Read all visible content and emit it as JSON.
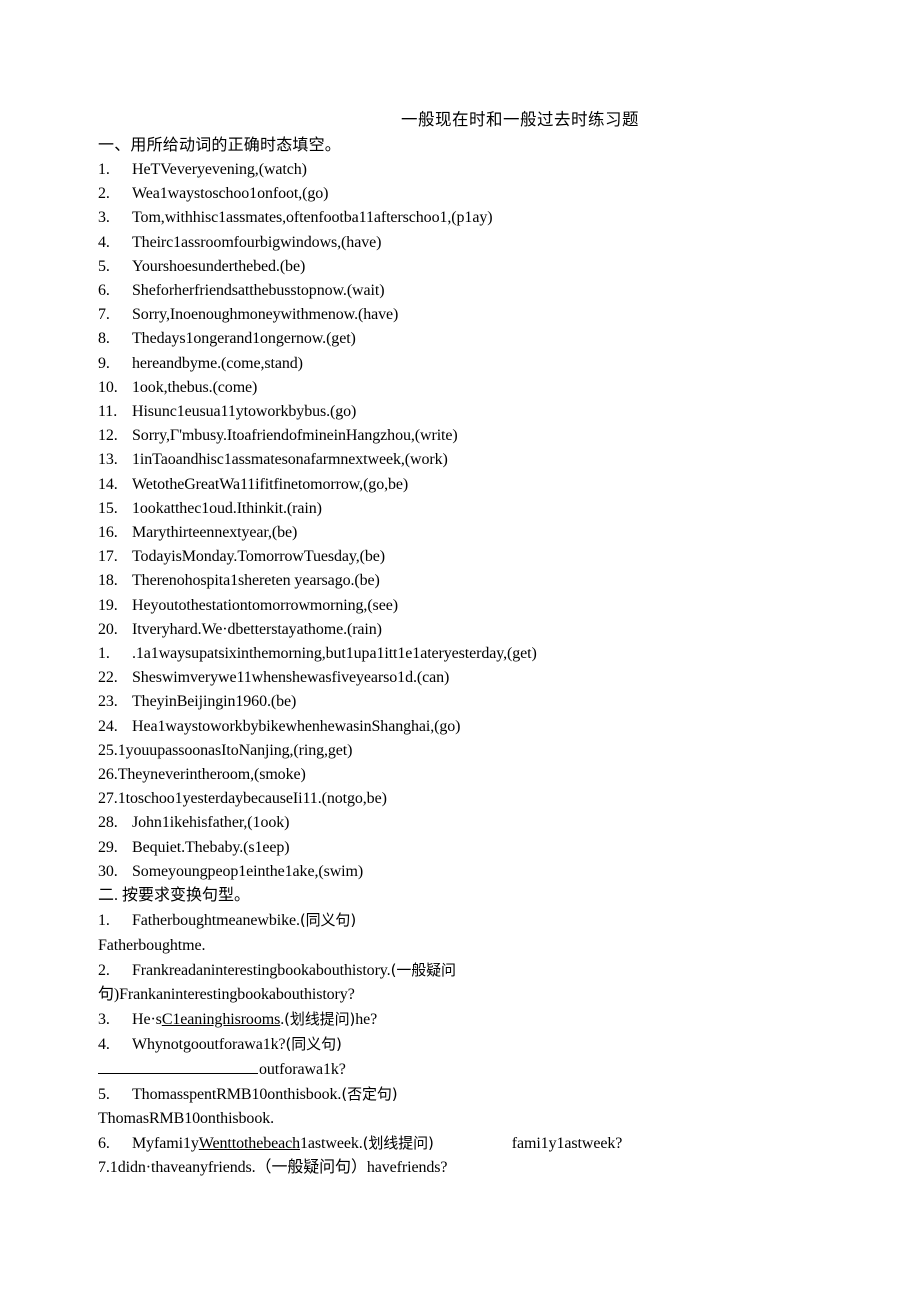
{
  "document": {
    "title": "一般现在时和一般过去时练习题",
    "sections": [
      {
        "heading": "一、用所给动词的正确时态填空。",
        "questions": [
          {
            "num": "1.",
            "text": "HeTVeveryevening,(watch)"
          },
          {
            "num": "2.",
            "text": "Wea1waystoschoo1onfoot,(go)"
          },
          {
            "num": "3.",
            "text": "Tom,withhisc1assmates,oftenfootba11afterschoo1,(p1ay)"
          },
          {
            "num": "4.",
            "text": "Theirc1assroomfourbigwindows,(have)"
          },
          {
            "num": "5.",
            "text": "Yourshoesunderthebed.(be)"
          },
          {
            "num": "6.",
            "text": "Sheforherfriendsatthebusstopnow.(wait)"
          },
          {
            "num": "7.",
            "text": "Sorry,Inoenoughmoneywithmenow.(have)"
          },
          {
            "num": "8.",
            "text": "Thedays1ongerand1ongernow.(get)"
          },
          {
            "num": "9.",
            "text": "hereandbyme.(come,stand)"
          },
          {
            "num": "10.",
            "text": "1ook,thebus.(come)"
          },
          {
            "num": "11.",
            "text": "Hisunc1eusua11ytoworkbybus.(go)"
          },
          {
            "num": "12.",
            "text": "Sorry,Г'mbusy.ItoafriendofmineinHangzhou,(write)"
          },
          {
            "num": "13.",
            "text": "1inTaoandhisc1assmatesonafarmnextweek,(work)"
          },
          {
            "num": "14.",
            "text": "WetotheGreatWa11ifitfinetomorrow,(go,be)"
          },
          {
            "num": "15.",
            "text": "1ookatthec1oud.Ithinkit.(rain)"
          },
          {
            "num": "16.",
            "text": "Marythirteennextyear,(be)"
          },
          {
            "num": "17.",
            "text": "TodayisMonday.TomorrowTuesday,(be)"
          },
          {
            "num": "18.",
            "text": "Therenohospita1shereten yearsago.(be)"
          },
          {
            "num": "19.",
            "text": "Heyoutothestationtomorrowmorning,(see)"
          },
          {
            "num": "20.",
            "text": "Itveryhard.We·dbetterstayathome.(rain)"
          },
          {
            "num": "1.",
            "text": ".1a1waysupatsixinthemorning,but1upa1itt1e1ateryesterday,(get)"
          },
          {
            "num": "22.",
            "text": "Sheswimverywe11whenshewasfiveyearso1d.(can)"
          },
          {
            "num": "23.",
            "text": "TheyinBeijingin1960.(be)"
          },
          {
            "num": "24.",
            "text": "Hea1waystoworkbybikewhenhewasinShanghai,(go)"
          },
          {
            "num": "25.",
            "text": "1youupassoonasItoNanjing,(ring,get)",
            "tight": true
          },
          {
            "num": "26.",
            "text": "Theyneverintheroom,(smoke)",
            "tight": true
          },
          {
            "num": "27.",
            "text": "1toschoo1yesterdaybecauseIi11.(notgo,be)",
            "tight": true
          },
          {
            "num": "28.",
            "text": "John1ikehisfather,(1ook)"
          },
          {
            "num": "29.",
            "text": "Bequiet.Thebaby.(s1eep)"
          },
          {
            "num": "30.",
            "text": "Someyoungpeop1einthe1ake,(swim)"
          }
        ]
      }
    ],
    "section_two": {
      "heading": "二. 按要求变换句型。",
      "items": [
        {
          "num": "1.",
          "lead": "Fatherboughtmeanewbike.",
          "paren": "(同义句)",
          "tail": "",
          "answer_line": "Fatherboughtme."
        },
        {
          "num": "2.",
          "lead": "Frankreadaninterestingbookabouthistory.",
          "paren_start": "(一般疑问",
          "wrap": "句)Frankaninterestingbookabouthistory?"
        },
        {
          "num": "3.",
          "pre": "He·s",
          "underlined": "C1eaninghisrooms",
          "post": ".",
          "paren": "(划线提问)",
          "tail": "he?"
        },
        {
          "num": "4.",
          "lead": "Whynotgooutforawa1k?",
          "paren": "(同义句)",
          "blank_tail": "outforawa1k?"
        },
        {
          "num": "5.",
          "lead": "ThomasspentRMB10onthisbook.",
          "paren": "(否定句)",
          "answer_line": "ThomasRMB10onthisbook."
        },
        {
          "num": "6.",
          "pre": "Myfami1y",
          "underlined": "Wenttothebeach",
          "post": "1astweek.",
          "paren": "(划线提问)",
          "tail": "fami1y1astweek?"
        },
        {
          "num": "7.",
          "full": "7.1didn·thaveanyfriends.（一般疑问句）havefriends?",
          "tight": true
        }
      ]
    }
  }
}
